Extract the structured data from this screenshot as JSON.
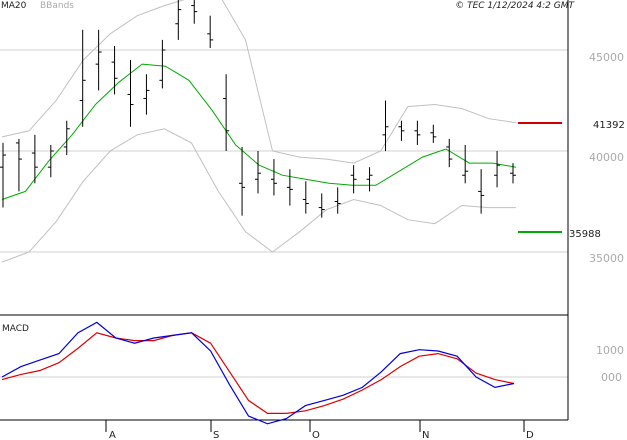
{
  "header": {
    "legend_ma": "MA20",
    "legend_bands": "BBands",
    "timestamp": "© TEC 1/12/2024 4:2 GMT"
  },
  "price_panel": {
    "y_ticks": [
      "45000",
      "40000",
      "35000"
    ],
    "resistance_label": "41392",
    "support_label": "35988"
  },
  "macd_panel": {
    "title": "MACD",
    "y_ticks": [
      "1000",
      "000"
    ]
  },
  "x_axis": {
    "ticks": [
      "A",
      "S",
      "O",
      "N",
      "D"
    ]
  },
  "colors": {
    "ma20": "#00aa00",
    "bbands": "#c0c0c0",
    "resistance": "#cc0000",
    "support": "#00aa00",
    "macd_line": "#0000dd",
    "signal_line": "#dd0000"
  },
  "chart_data": [
    {
      "type": "bar",
      "subtype": "ohlc",
      "ylim": [
        33000,
        48500
      ],
      "y_ticks": [
        35000,
        40000,
        45000
      ],
      "x_ticks": [
        "A",
        "S",
        "O",
        "N",
        "D"
      ],
      "series": [
        {
          "name": "",
          "ohlc_sampled": [
            [
              39200,
              40400,
              37200,
              39800
            ],
            [
              40400,
              40600,
              38000,
              39600
            ],
            [
              39900,
              40800,
              38400,
              39200
            ],
            [
              39200,
              40300,
              38700,
              40000
            ],
            [
              40200,
              41500,
              39800,
              41100
            ],
            [
              42500,
              46000,
              41200,
              43500
            ],
            [
              44300,
              46000,
              43000,
              44900
            ],
            [
              44400,
              45200,
              42800,
              43600
            ],
            [
              42800,
              44500,
              41200,
              42300
            ],
            [
              42600,
              43800,
              41800,
              43000
            ],
            [
              43500,
              45500,
              43100,
              45000
            ],
            [
              46300,
              47600,
              45500,
              47000
            ],
            [
              47200,
              47800,
              46300,
              46900
            ],
            [
              45800,
              46700,
              45100,
              45500
            ],
            [
              42600,
              43800,
              40000,
              41000
            ],
            [
              38400,
              40200,
              36800,
              38200
            ],
            [
              38600,
              40000,
              37900,
              38900
            ],
            [
              38600,
              39600,
              37800,
              38400
            ],
            [
              38200,
              39100,
              37300,
              38100
            ],
            [
              37600,
              38500,
              36900,
              37400
            ],
            [
              37200,
              37900,
              36700,
              37100
            ],
            [
              37500,
              38200,
              36900,
              37400
            ],
            [
              38800,
              39300,
              37900,
              38600
            ],
            [
              38600,
              39200,
              38000,
              38800
            ],
            [
              40800,
              42500,
              40000,
              41200
            ],
            [
              41200,
              41500,
              40500,
              41000
            ],
            [
              41000,
              41500,
              40300,
              40800
            ],
            [
              40900,
              41300,
              40400,
              40700
            ],
            [
              40200,
              40600,
              39200,
              39600
            ],
            [
              38800,
              40300,
              38400,
              39000
            ],
            [
              38000,
              39100,
              36900,
              37800
            ],
            [
              38800,
              40000,
              38200,
              39300
            ],
            [
              38900,
              39400,
              38400,
              38800
            ]
          ]
        },
        {
          "name": "MA20",
          "values": [
            37600,
            38000,
            39500,
            40800,
            42300,
            43400,
            44300,
            44200,
            43500,
            42000,
            40300,
            39300,
            38800,
            38600,
            38400,
            38300,
            38300,
            39000,
            39700,
            40100,
            39400,
            39400,
            39200
          ]
        },
        {
          "name": "BBands upper",
          "values": [
            40700,
            41000,
            42500,
            44500,
            45800,
            46700,
            47200,
            47600,
            47800,
            45500,
            40000,
            39700,
            39600,
            39400,
            40000,
            42200,
            42300,
            42100,
            41600,
            41400
          ]
        },
        {
          "name": "BBands lower",
          "values": [
            34500,
            35000,
            36500,
            38500,
            40000,
            40800,
            41100,
            40400,
            38000,
            36000,
            35000,
            36000,
            37100,
            37600,
            37300,
            36600,
            36400,
            37300,
            37200,
            37200
          ]
        }
      ],
      "horizontal_lines": [
        {
          "label": "41392",
          "value": 41392
        },
        {
          "label": "35988",
          "value": 35988
        }
      ]
    },
    {
      "type": "line",
      "title": "MACD",
      "ylim": [
        -2000,
        2500
      ],
      "y_ticks": [
        0,
        1000
      ],
      "series": [
        {
          "name": "",
          "values": [
            0,
            400,
            650,
            900,
            1700,
            2100,
            1500,
            1300,
            1500,
            1600,
            1700,
            1000,
            -300,
            -1500,
            -1800,
            -1600,
            -1100,
            -900,
            -700,
            -400,
            200,
            900,
            1050,
            1000,
            800,
            0,
            -400,
            -250
          ]
        },
        {
          "name": "",
          "values": [
            -100,
            100,
            250,
            550,
            1100,
            1700,
            1500,
            1400,
            1400,
            1600,
            1700,
            1300,
            200,
            -900,
            -1400,
            -1400,
            -1300,
            -1100,
            -850,
            -500,
            -100,
            400,
            800,
            900,
            700,
            150,
            -100,
            -250
          ]
        }
      ]
    }
  ]
}
